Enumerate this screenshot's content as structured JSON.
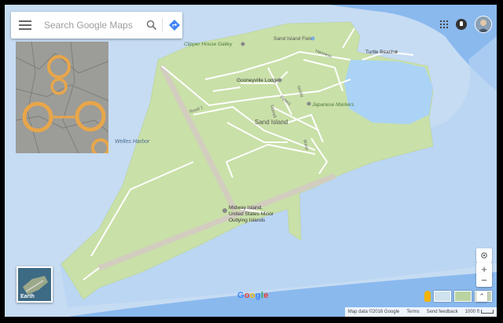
{
  "search": {
    "placeholder": "Search Google Maps"
  },
  "map_labels": {
    "sand_island_field": "Sand Island Field",
    "clipper_house": "Clipper House Galley",
    "henness": "Henness",
    "turtle_beach": "Turtle Beach",
    "gooneyville": "Gooneyville Lodge",
    "nimitz": "Nimitz",
    "peters": "Peters",
    "road1": "Road 1",
    "japanese_markers": "Japanese Markers",
    "sand_island": "Sand Island",
    "morrell": "Morrell",
    "welles": "Welles Harbor",
    "wasp": "Wasp",
    "midway_1": "Midway Island,",
    "midway_2": "United States Minor",
    "midway_3": "Outlying Islands"
  },
  "earth": {
    "label": "Earth"
  },
  "google_logo": "Google",
  "footer": {
    "attribution": "Map data ©2016 Google",
    "terms": "Terms",
    "feedback": "Send feedback",
    "scale": "1000 ft"
  },
  "controls": {
    "zoom_in": "+",
    "zoom_out": "−",
    "collapse": "⌃"
  },
  "colors": {
    "land": "#c9e0a8",
    "water": "#aad3f5",
    "deep_water": "#7fb3ea",
    "roads": "#ffffff",
    "runway": "#d2cdbf"
  }
}
